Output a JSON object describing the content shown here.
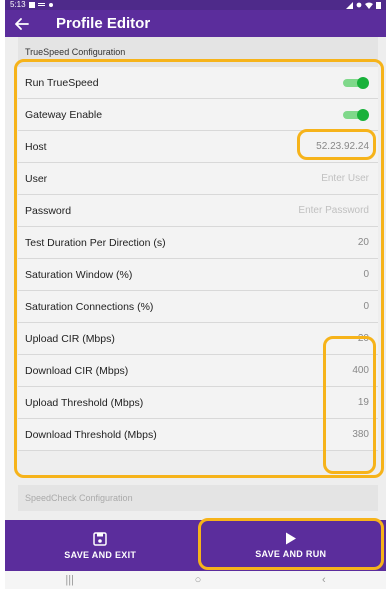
{
  "status_bar": {
    "time": "5:13"
  },
  "app_bar": {
    "title": "Profile Editor"
  },
  "section": {
    "title": "TrueSpeed Configuration"
  },
  "rows": [
    {
      "label": "Run TrueSpeed",
      "type": "toggle",
      "on": true
    },
    {
      "label": "Gateway Enable",
      "type": "toggle",
      "on": true
    },
    {
      "label": "Host",
      "type": "value",
      "value": "52.23.92.24"
    },
    {
      "label": "User",
      "type": "placeholder",
      "placeholder": "Enter User"
    },
    {
      "label": "Password",
      "type": "placeholder",
      "placeholder": "Enter Password"
    },
    {
      "label": "Test Duration Per Direction (s)",
      "type": "value",
      "value": "20"
    },
    {
      "label": "Saturation Window (%)",
      "type": "value",
      "value": "0"
    },
    {
      "label": "Saturation Connections (%)",
      "type": "value",
      "value": "0"
    },
    {
      "label": "Upload CIR (Mbps)",
      "type": "value",
      "value": "20"
    },
    {
      "label": "Download CIR (Mbps)",
      "type": "value",
      "value": "400"
    },
    {
      "label": "Upload Threshold (Mbps)",
      "type": "value",
      "value": "19"
    },
    {
      "label": "Download Threshold (Mbps)",
      "type": "value",
      "value": "380"
    }
  ],
  "next_section": {
    "title": "SpeedCheck Configuration"
  },
  "buttons": {
    "save_exit": "SAVE AND EXIT",
    "save_run": "SAVE AND RUN"
  },
  "nav": {
    "recents": "|||",
    "home": "○",
    "back": "‹"
  },
  "colors": {
    "header_purple": "#5b2d9c",
    "toggle_green": "#18b13a",
    "highlight_orange": "#f6b31a"
  }
}
